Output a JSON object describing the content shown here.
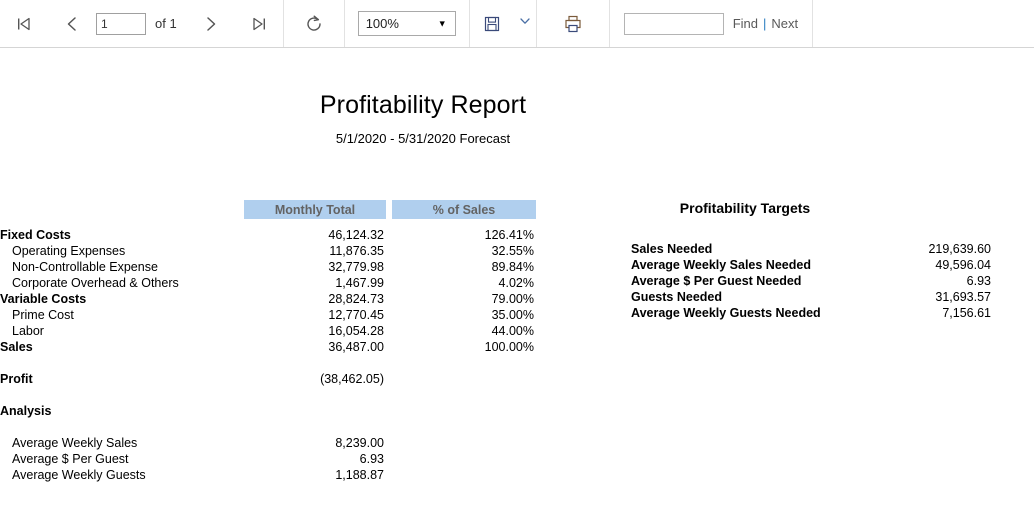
{
  "toolbar": {
    "first_page_icon": "first-page-icon",
    "prev_page_icon": "previous-page-icon",
    "page_number": "1",
    "page_of_label": "of 1",
    "next_page_icon": "next-page-icon",
    "last_page_icon": "last-page-icon",
    "refresh_icon": "refresh-icon",
    "zoom_value": "100%",
    "zoom_caret_icon": "chevron-down-icon",
    "save_icon": "save-disk-icon",
    "save_caret_icon": "chevron-down-icon",
    "print_icon": "printer-icon",
    "find_value": "",
    "find_placeholder": "",
    "find_label": "Find",
    "find_separator": "|",
    "next_label": "Next"
  },
  "report": {
    "title": "Profitability Report",
    "subtitle": "5/1/2020 - 5/31/2020 Forecast",
    "table": {
      "headers": [
        "Monthly Total",
        "% of Sales"
      ],
      "rows": [
        {
          "label": "Fixed Costs",
          "bold": true,
          "indent": false,
          "monthly": "46,124.32",
          "pct": "126.41%"
        },
        {
          "label": "Operating Expenses",
          "bold": false,
          "indent": true,
          "monthly": "11,876.35",
          "pct": "32.55%"
        },
        {
          "label": "Non-Controllable Expense",
          "bold": false,
          "indent": true,
          "monthly": "32,779.98",
          "pct": "89.84%"
        },
        {
          "label": "Corporate Overhead & Others",
          "bold": false,
          "indent": true,
          "monthly": "1,467.99",
          "pct": "4.02%"
        },
        {
          "label": "Variable Costs",
          "bold": true,
          "indent": false,
          "monthly": "28,824.73",
          "pct": "79.00%"
        },
        {
          "label": "Prime Cost",
          "bold": false,
          "indent": true,
          "monthly": "12,770.45",
          "pct": "35.00%"
        },
        {
          "label": "Labor",
          "bold": false,
          "indent": true,
          "monthly": "16,054.28",
          "pct": "44.00%"
        },
        {
          "label": "Sales",
          "bold": true,
          "indent": false,
          "monthly": "36,487.00",
          "pct": "100.00%"
        },
        {
          "label": "Profit",
          "bold": true,
          "indent": false,
          "monthly": "(38,462.05)",
          "pct": ""
        },
        {
          "label": "Analysis",
          "bold": true,
          "indent": false,
          "monthly": "",
          "pct": ""
        },
        {
          "label": "Average Weekly Sales",
          "bold": false,
          "indent": true,
          "monthly": "8,239.00",
          "pct": ""
        },
        {
          "label": "Average $ Per Guest",
          "bold": false,
          "indent": true,
          "monthly": "6.93",
          "pct": ""
        },
        {
          "label": "Average Weekly Guests",
          "bold": false,
          "indent": true,
          "monthly": "1,188.87",
          "pct": ""
        }
      ]
    },
    "targets": {
      "title": "Profitability Targets",
      "rows": [
        {
          "label": "Sales Needed",
          "value": "219,639.60"
        },
        {
          "label": "Average Weekly Sales Needed",
          "value": "49,596.04"
        },
        {
          "label": "Average $ Per Guest Needed",
          "value": "6.93"
        },
        {
          "label": "Guests Needed",
          "value": "31,693.57"
        },
        {
          "label": "Average Weekly Guests Needed",
          "value": "7,156.61"
        }
      ]
    }
  },
  "colors": {
    "header_fill": "#b0cfee",
    "header_text": "#636363",
    "accent_link": "#2b7ec1"
  }
}
